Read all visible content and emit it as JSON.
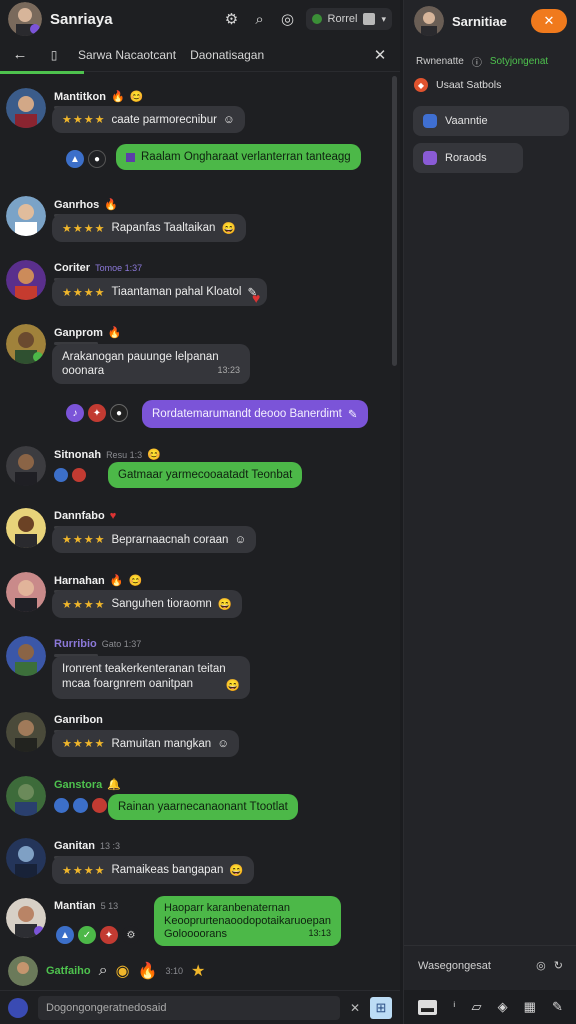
{
  "app": {
    "title": "Sanriaya"
  },
  "topbar": {
    "profile_label": "Rorrel",
    "icons": [
      "discover-icon",
      "search-icon",
      "settings-icon"
    ]
  },
  "tabs": [
    {
      "label": "Sarwa Nacaotcant"
    },
    {
      "label": "Daonatisagan"
    }
  ],
  "messages": [
    {
      "name": "Mantitkon",
      "text": "caate parmorecnibur",
      "rating": "★★★★",
      "type": "gray"
    },
    {
      "name": "",
      "text": "Raalam Ongharaat verlanterran tanteagg",
      "type": "green"
    },
    {
      "name": "Ganrhos",
      "text": "Rapanfas Taaltaikan",
      "rating": "★★★★",
      "type": "gray"
    },
    {
      "name": "Coriter",
      "meta": "Tomoe 1:37",
      "text": "Tiaantaman pahal Kloatol",
      "rating": "★★★★",
      "type": "gray"
    },
    {
      "name": "Ganprom",
      "text": "Arakanogan pauunge lelpanan",
      "text2": "ooonara",
      "time": "13:23",
      "type": "gray"
    },
    {
      "name": "",
      "text": "Rordatemarumandt deooo Banerdimt",
      "type": "purple"
    },
    {
      "name": "Sitnonah",
      "meta": "Resu 1:3",
      "text": "Gatmaar yarmecooaatadt Teonbat",
      "type": "green"
    },
    {
      "name": "Dannfabo",
      "text": "Beprarnaacnah coraan",
      "rating": "★★★★",
      "type": "gray"
    },
    {
      "name": "Harnahan",
      "text": "Sanguhen tioraomn",
      "rating": "★★★★",
      "type": "gray"
    },
    {
      "name": "Rurribio",
      "meta": "Gato 1:37",
      "text": "Ironrent teakerkenteranan teitan",
      "text2": "mcaa foargnrem oanitpan",
      "type": "gray"
    },
    {
      "name": "Ganribon",
      "text": "Ramuitan mangkan",
      "rating": "★★★★",
      "type": "gray"
    },
    {
      "name": "Ganstora",
      "text": "Rainan yaarnecanaonant Ttootlat",
      "type": "green"
    },
    {
      "name": "Ganitan",
      "meta": "13 :3",
      "text": "Ramaikeas bangapan",
      "rating": "★★★★",
      "type": "gray"
    },
    {
      "name": "Mantian",
      "meta": "5 13",
      "text": "Haoparr karanbenaternan",
      "text2": "Keooprurtenaoodopotaikaruoepan",
      "text3": "Goloooorans",
      "time": "13:13",
      "type": "green"
    }
  ],
  "peek": {
    "name": "Gatfaiho",
    "meta": "3:10"
  },
  "composer": {
    "placeholder": "Dogongongeratnedosaid"
  },
  "side": {
    "title": "Sarnitiae",
    "meta_left": "Rwnenatte",
    "meta_right": "Sotyjongenat",
    "row_label": "Usaat Satbols",
    "chips": [
      {
        "label": "Vaanntie",
        "color": "#3f6fd1"
      },
      {
        "label": "Roraods",
        "color": "#8a5bd6"
      }
    ],
    "search_placeholder": "Wasegongesat"
  }
}
